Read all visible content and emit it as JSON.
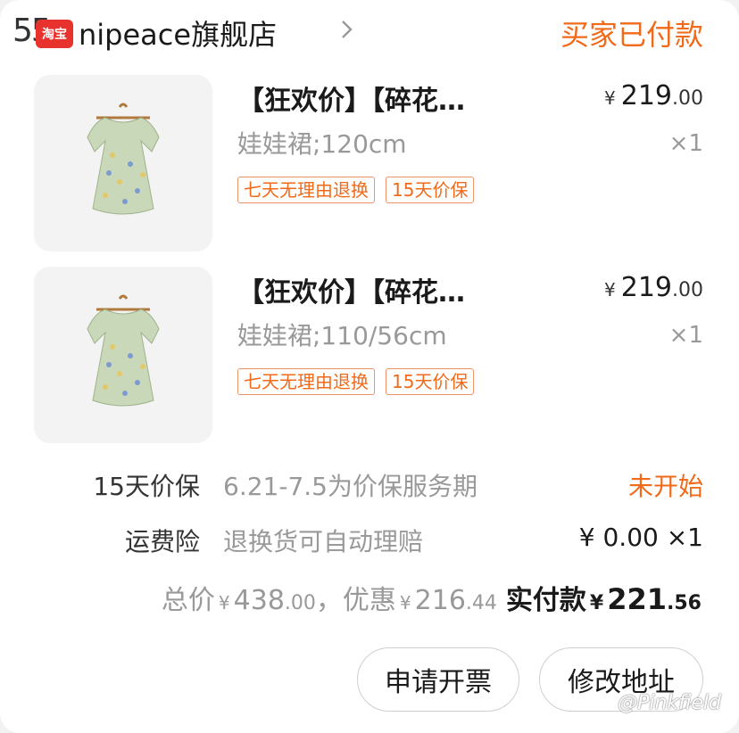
{
  "header": {
    "watermark_number": "55",
    "store_badge": "淘宝",
    "store_name": "nipeace旗舰店",
    "order_status": "买家已付款"
  },
  "items": [
    {
      "title": "【狂欢价】【碎花…",
      "spec": "娃娃裙;120cm",
      "tags": [
        "七天无理由退换",
        "15天价保"
      ],
      "price_yen": "¥",
      "price_int": "219",
      "price_dec": ".00",
      "qty": "×1"
    },
    {
      "title": "【狂欢价】【碎花…",
      "spec": "娃娃裙;110/56cm",
      "tags": [
        "七天无理由退换",
        "15天价保"
      ],
      "price_yen": "¥",
      "price_int": "219",
      "price_dec": ".00",
      "qty": "×1"
    }
  ],
  "services": [
    {
      "label": "15天价保",
      "desc": "6.21-7.5为价保服务期",
      "right": "未开始",
      "right_color": "#f06a1a"
    },
    {
      "label": "运费险",
      "desc": "退换货可自动理赔",
      "right": "¥ 0.00 ×1",
      "right_color": "#1a1a1a"
    }
  ],
  "totals": {
    "total_label": "总价",
    "total_yen": "¥",
    "total_int": "438",
    "total_dec": ".00",
    "sep": "，",
    "discount_label": "优惠",
    "discount_yen": "¥",
    "discount_int": "216",
    "discount_dec": ".44",
    "paid_label": "实付款",
    "paid_yen": "¥",
    "paid_int": "221",
    "paid_dec": ".56"
  },
  "actions": {
    "invoice_label": "申请开票",
    "address_label": "修改地址"
  },
  "watermark": "@Pinkfield",
  "colors": {
    "accent": "#f06a1a",
    "muted": "#999999",
    "text": "#1a1a1a"
  }
}
